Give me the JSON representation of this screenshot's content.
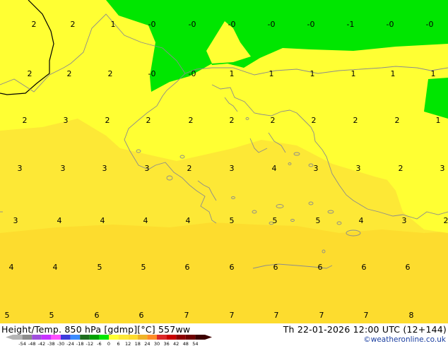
{
  "header": {
    "title": "Height/Temp. 850 hPa [gdmp][°C] 557ww",
    "datetime": "Th 22-01-2026 12:00 UTC (12+144)",
    "credit": "©weatheronline.co.uk"
  },
  "colors": {
    "band_0_1": "#ffff33",
    "band_3_4": "#fde836",
    "band_5_6": "#fddc2e",
    "band_neg": "#00e600",
    "coast": "#8c8c8c",
    "border": "#000000"
  },
  "map": {
    "grid_values": [
      [
        "2",
        "2",
        "1",
        "-0",
        "-0",
        "-0",
        "-0",
        "-0",
        "-1",
        "-0",
        "-0"
      ],
      [
        "2",
        "2",
        "2",
        "-0",
        "-0",
        "1",
        "1",
        "1",
        "1",
        "1",
        "1"
      ],
      [
        "2",
        "3",
        "2",
        "2",
        "2",
        "2",
        "2",
        "2",
        "2",
        "2",
        "1"
      ],
      [
        "3",
        "3",
        "3",
        "3",
        "2",
        "3",
        "4",
        "3",
        "3",
        "2",
        "3"
      ],
      [
        "3",
        "4",
        "4",
        "4",
        "4",
        "5",
        "5",
        "5",
        "4",
        "3",
        "2"
      ],
      [
        "4",
        "4",
        "5",
        "5",
        "6",
        "6",
        "6",
        "6",
        "6",
        "6"
      ],
      [
        "5",
        "5",
        "6",
        "6",
        "7",
        "7",
        "7",
        "7",
        "7",
        "8"
      ]
    ]
  },
  "legend": {
    "ticks": [
      "-54",
      "-48",
      "-42",
      "-38",
      "-30",
      "-24",
      "-18",
      "-12",
      "-6",
      "0",
      "6",
      "12",
      "18",
      "24",
      "30",
      "36",
      "42",
      "48",
      "54"
    ],
    "colors": [
      "#b4b4b4",
      "#8c8c8c",
      "#a050dc",
      "#c832ff",
      "#ff50ff",
      "#3c3cdc",
      "#3c8cff",
      "#1e6e1e",
      "#00a000",
      "#00e600",
      "#ffff33",
      "#fde836",
      "#fddc2e",
      "#f0b428",
      "#ff8c28",
      "#dc2828",
      "#c80000",
      "#8c0000",
      "#6e0000",
      "#3c0000"
    ]
  }
}
